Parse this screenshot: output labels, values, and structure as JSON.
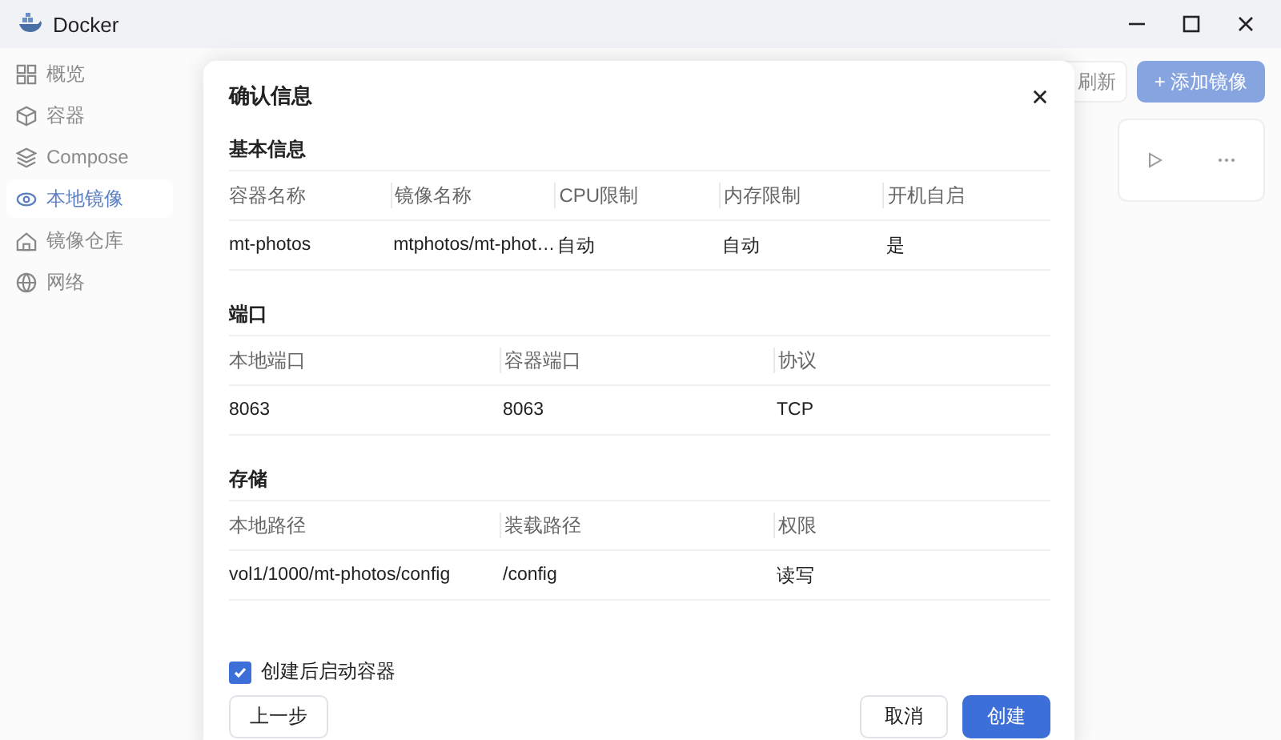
{
  "window": {
    "title": "Docker"
  },
  "sidebar": {
    "items": [
      {
        "label": "概览",
        "selected": false
      },
      {
        "label": "容器",
        "selected": false
      },
      {
        "label": "Compose",
        "selected": false
      },
      {
        "label": "本地镜像",
        "selected": true
      },
      {
        "label": "镜像仓库",
        "selected": false
      },
      {
        "label": "网络",
        "selected": false
      }
    ]
  },
  "toolbar": {
    "buttons": [
      {
        "label": "刷新",
        "kind": "secondary"
      },
      {
        "label": "+ 添加镜像",
        "kind": "primary"
      }
    ]
  },
  "dialog": {
    "title": "确认信息",
    "sections": [
      {
        "title": "基本信息",
        "columns": [
          "容器名称",
          "镜像名称",
          "CPU限制",
          "内存限制",
          "开机自启"
        ],
        "rows": [
          [
            "mt-photos",
            "mtphotos/mt-phot…",
            "自动",
            "自动",
            "是"
          ]
        ]
      },
      {
        "title": "端口",
        "columns": [
          "本地端口",
          "容器端口",
          "协议"
        ],
        "rows": [
          [
            "8063",
            "8063",
            "TCP"
          ]
        ]
      },
      {
        "title": "存储",
        "columns": [
          "本地路径",
          "装载路径",
          "权限"
        ],
        "rows": [
          [
            "vol1/1000/mt-photos/config",
            "/config",
            "读写"
          ]
        ]
      }
    ],
    "start_after_create": {
      "label": "创建后启动容器",
      "checked": true
    },
    "buttons_left": [
      {
        "label": "上一步",
        "kind": "secondary"
      }
    ],
    "buttons_right": [
      {
        "label": "取消",
        "kind": "secondary"
      },
      {
        "label": "创建",
        "kind": "primary"
      }
    ]
  }
}
